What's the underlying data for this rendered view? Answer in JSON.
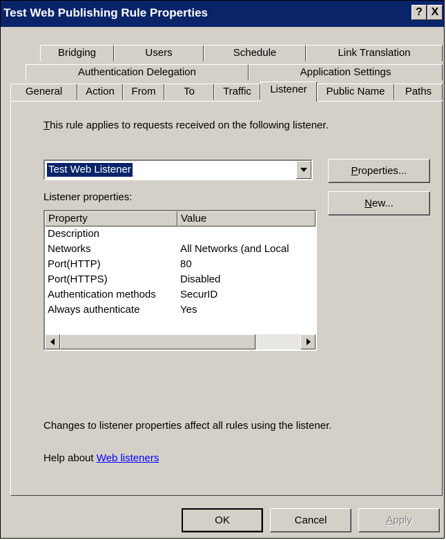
{
  "window": {
    "title": "Test Web Publishing Rule Properties",
    "help_label": "?",
    "close_label": "X"
  },
  "tabs": {
    "row1": [
      "Bridging",
      "Users",
      "Schedule",
      "Link Translation"
    ],
    "row2": [
      "Authentication Delegation",
      "Application Settings"
    ],
    "row3": [
      "General",
      "Action",
      "From",
      "To",
      "Traffic",
      "Listener",
      "Public Name",
      "Paths"
    ],
    "active": "Listener"
  },
  "listener": {
    "intro": {
      "first_letter": "T",
      "rest": "his rule applies to requests received on the following listener."
    },
    "selected": "Test Web Listener",
    "properties_button": {
      "accel": "P",
      "rest": "roperties..."
    },
    "new_button": {
      "accel": "N",
      "rest": "ew..."
    },
    "listener_props_label": "Listener properties:",
    "table": {
      "headers": [
        "Property",
        "Value"
      ],
      "rows": [
        [
          "Description",
          ""
        ],
        [
          "Networks",
          "All Networks (and Local"
        ],
        [
          "Port(HTTP)",
          "80"
        ],
        [
          "Port(HTTPS)",
          "Disabled"
        ],
        [
          "Authentication methods",
          "SecurID"
        ],
        [
          "Always authenticate",
          "Yes"
        ]
      ]
    },
    "changes_note": "Changes to listener properties affect all rules using the listener.",
    "help_prefix": "Help about ",
    "help_link": "Web listeners"
  },
  "footer": {
    "ok": "OK",
    "cancel": "Cancel",
    "apply_accel": "A",
    "apply_rest": "pply"
  }
}
